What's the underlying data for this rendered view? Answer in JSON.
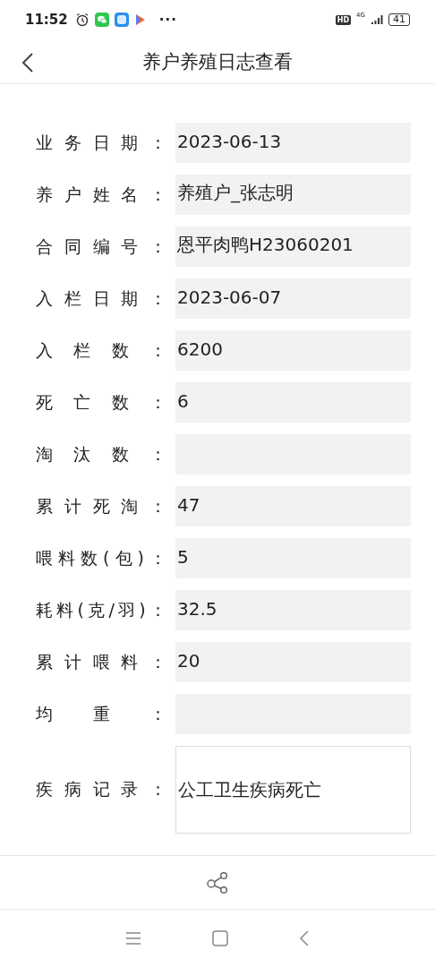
{
  "status_bar": {
    "time": "11:52",
    "more": "···",
    "hd": "HD",
    "network": "4G",
    "battery": "41"
  },
  "header": {
    "title": "养户养殖日志查看"
  },
  "fields": [
    {
      "kind": "text",
      "label": "业务日期：",
      "value": "2023-06-13"
    },
    {
      "kind": "text",
      "label": "养户姓名：",
      "value": "养殖户_张志明"
    },
    {
      "kind": "text",
      "label": "合同编号：",
      "value": "恩平肉鸭H23060201"
    },
    {
      "kind": "text",
      "label": "入栏日期：",
      "value": "2023-06-07"
    },
    {
      "kind": "text",
      "label": "入栏数：",
      "value": "6200"
    },
    {
      "kind": "text",
      "label": "死亡数：",
      "value": "6"
    },
    {
      "kind": "text",
      "label": "淘汰数："
    },
    {
      "kind": "text",
      "label": "累计死淘：",
      "value": "47"
    },
    {
      "kind": "text",
      "label": "喂料数(包)：",
      "value": "5"
    },
    {
      "kind": "text",
      "label": "耗料(克/羽)：",
      "value": "32.5"
    },
    {
      "kind": "text",
      "label": "累计喂料：",
      "value": "20"
    },
    {
      "kind": "text",
      "label": "均重："
    },
    {
      "kind": "textarea",
      "label": "疾病记录：",
      "value": "公工卫生疾病死亡"
    }
  ]
}
